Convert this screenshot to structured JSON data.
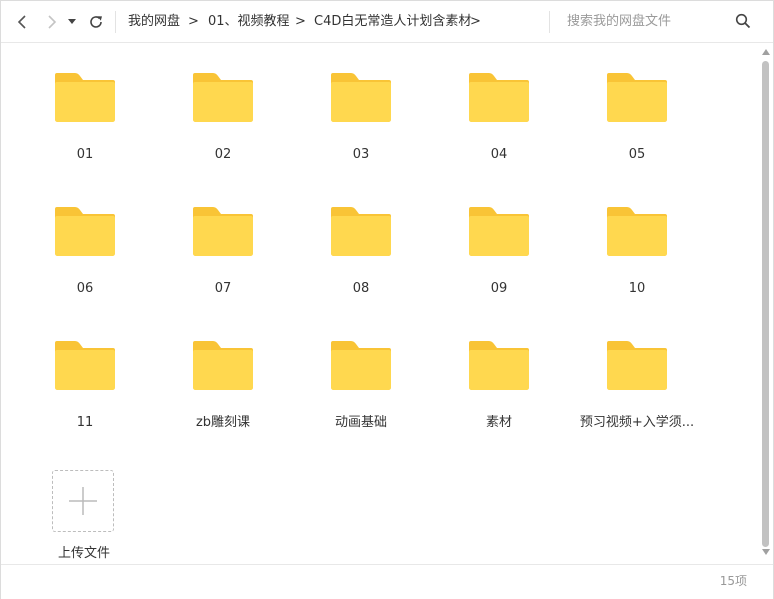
{
  "breadcrumb": {
    "items": [
      {
        "label": "我的网盘"
      },
      {
        "label": "01、视频教程"
      },
      {
        "label": "C4D白无常造人计划含素材"
      }
    ],
    "separator": ">"
  },
  "search": {
    "placeholder": "搜索我的网盘文件"
  },
  "colors": {
    "folder_front": "#FFD84F",
    "folder_back": "#F9C436"
  },
  "folders": [
    {
      "name": "01"
    },
    {
      "name": "02"
    },
    {
      "name": "03"
    },
    {
      "name": "04"
    },
    {
      "name": "05"
    },
    {
      "name": "06"
    },
    {
      "name": "07"
    },
    {
      "name": "08"
    },
    {
      "name": "09"
    },
    {
      "name": "10"
    },
    {
      "name": "11"
    },
    {
      "name": "zb雕刻课"
    },
    {
      "name": "动画基础"
    },
    {
      "name": "素材"
    },
    {
      "name": "预习视频+入学须..."
    }
  ],
  "upload": {
    "label": "上传文件"
  },
  "footer": {
    "count": "15项"
  }
}
